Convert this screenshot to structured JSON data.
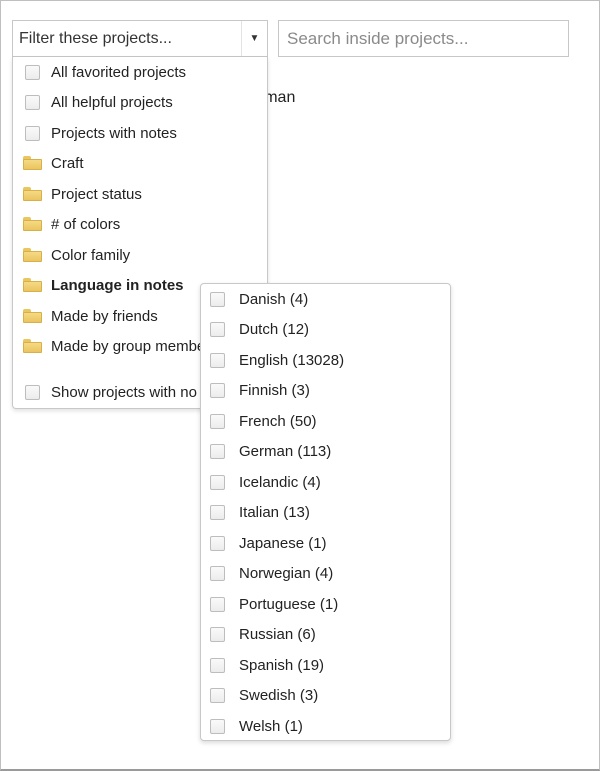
{
  "filter": {
    "label": "Filter these projects...",
    "arrow": "▼"
  },
  "search": {
    "placeholder": "Search inside projects..."
  },
  "background_text": "erman",
  "menu": {
    "items": [
      {
        "label": "All favorited projects",
        "icon": "checkbox-icon"
      },
      {
        "label": "All helpful projects",
        "icon": "checkbox-icon"
      },
      {
        "label": "Projects with notes",
        "icon": "checkbox-icon"
      },
      {
        "label": "Craft",
        "icon": "folder-icon"
      },
      {
        "label": "Project status",
        "icon": "folder-icon"
      },
      {
        "label": "# of colors",
        "icon": "folder-icon"
      },
      {
        "label": "Color family",
        "icon": "folder-icon"
      },
      {
        "label": "Language in notes",
        "icon": "folder-icon"
      },
      {
        "label": "Made by friends",
        "icon": "folder-icon"
      },
      {
        "label": "Made by group membe",
        "icon": "folder-icon"
      }
    ],
    "footer": {
      "label": "Show projects with no",
      "icon": "checkbox-icon"
    }
  },
  "submenu": {
    "items": [
      {
        "label": "Danish (4)"
      },
      {
        "label": "Dutch (12)"
      },
      {
        "label": "English (13028)"
      },
      {
        "label": "Finnish (3)"
      },
      {
        "label": "French (50)"
      },
      {
        "label": "German (113)"
      },
      {
        "label": "Icelandic (4)"
      },
      {
        "label": "Italian (13)"
      },
      {
        "label": "Japanese (1)"
      },
      {
        "label": "Norwegian (4)"
      },
      {
        "label": "Portuguese (1)"
      },
      {
        "label": "Russian (6)"
      },
      {
        "label": "Spanish (19)"
      },
      {
        "label": "Swedish (3)"
      },
      {
        "label": "Welsh (1)"
      }
    ]
  }
}
